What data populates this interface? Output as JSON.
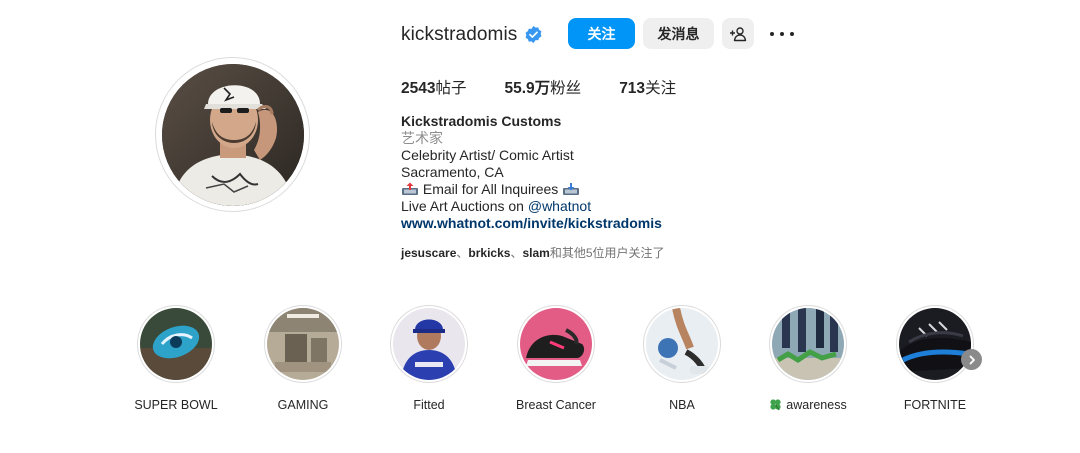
{
  "profile": {
    "username": "kickstradomis",
    "verified_icon": "verified-badge-icon",
    "follow_label": "关注",
    "message_label": "发消息",
    "add_user_icon": "add-user-icon",
    "more_icon": "more-options-icon"
  },
  "stats": {
    "posts_value": "2543",
    "posts_label": "帖子",
    "followers_value": "55.9万",
    "followers_label": "粉丝",
    "following_value": "713",
    "following_label": "关注"
  },
  "bio": {
    "full_name": "Kickstradomis Customs",
    "category": "艺术家",
    "line1": "Celebrity Artist/ Comic Artist",
    "line2": "Sacramento, CA",
    "line3_text": " Email for All Inquirees ",
    "line4_prefix": "Live Art Auctions on ",
    "line4_mention": "@whatnot",
    "website": "www.whatnot.com/invite/kickstradomis"
  },
  "followed_by": {
    "user1": "jesuscare",
    "sep1": "、",
    "user2": "brkicks",
    "sep2": "、",
    "user3": "slam",
    "suffix": "和其他5位用户关注了"
  },
  "highlights": [
    {
      "label": "SUPER BOWL"
    },
    {
      "label": "GAMING"
    },
    {
      "label": "Fitted"
    },
    {
      "label": "Breast Cancer"
    },
    {
      "label": "NBA"
    },
    {
      "label": "awareness",
      "icon": "four-leaf-clover-icon"
    },
    {
      "label": "FORTNITE"
    }
  ],
  "colors": {
    "accent": "#0095f6",
    "link": "#00376b",
    "secondary_button": "#efefef",
    "muted_text": "#8e8e8e"
  }
}
